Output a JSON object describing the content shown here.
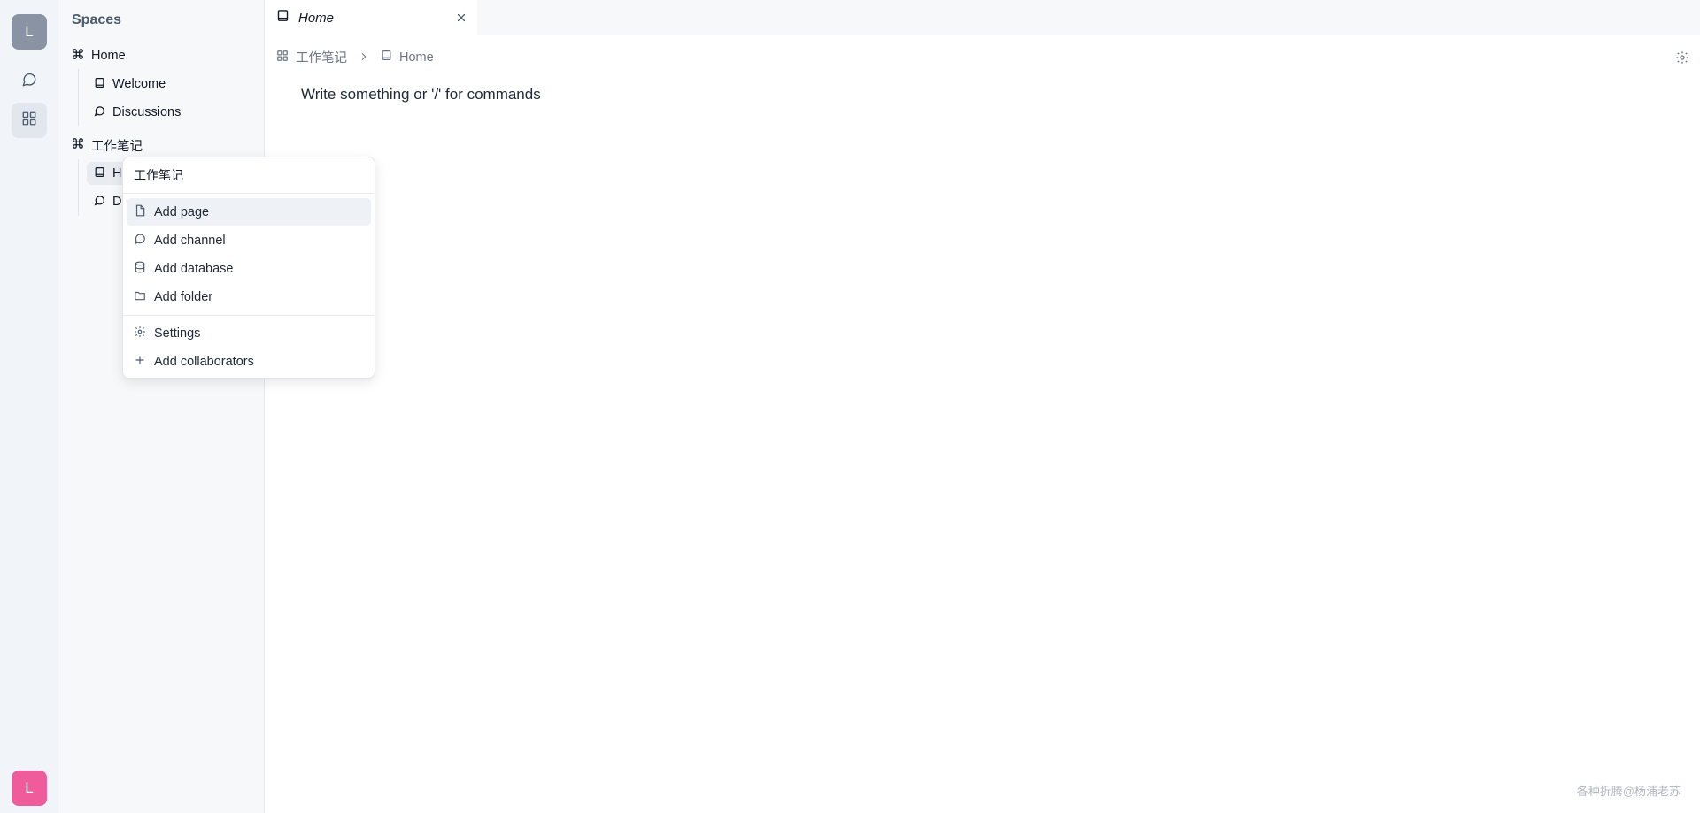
{
  "rail": {
    "user_initial_top": "L",
    "user_initial_bottom": "L",
    "chat_icon": "chat-bubble-icon",
    "spaces_icon": "grid-icon"
  },
  "sidebar": {
    "title": "Spaces",
    "spaces": [
      {
        "label": "Home",
        "icon": "command-icon",
        "children": [
          {
            "label": "Welcome",
            "icon": "book-icon"
          },
          {
            "label": "Discussions",
            "icon": "chat-bubble-icon"
          }
        ]
      },
      {
        "label": "工作笔记",
        "icon": "command-icon",
        "children": [
          {
            "label": "H",
            "icon": "book-icon"
          },
          {
            "label": "D",
            "icon": "chat-bubble-icon"
          }
        ]
      }
    ]
  },
  "tabs": [
    {
      "label": "Home",
      "icon": "book-icon",
      "close_icon": "close-icon"
    }
  ],
  "breadcrumb": {
    "items": [
      {
        "label": "工作笔记",
        "icon": "command-icon"
      },
      {
        "label": "Home",
        "icon": "book-icon"
      }
    ],
    "separator_icon": "chevron-right-icon"
  },
  "settings_icon": "gear-icon",
  "editor": {
    "placeholder": "Write something or '/' for commands"
  },
  "context_menu": {
    "header": "工作笔记",
    "items": [
      {
        "label": "Add page",
        "icon": "file-icon"
      },
      {
        "label": "Add channel",
        "icon": "chat-bubble-icon"
      },
      {
        "label": "Add database",
        "icon": "database-icon"
      },
      {
        "label": "Add folder",
        "icon": "folder-icon"
      }
    ],
    "secondary_items": [
      {
        "label": "Settings",
        "icon": "gear-icon"
      },
      {
        "label": "Add collaborators",
        "icon": "plus-icon"
      }
    ]
  },
  "watermark": "各种折腾@杨浦老苏",
  "colors": {
    "rail_bg": "#f1f4f8",
    "sidebar_bg": "#f7f8fa",
    "avatar_top": "#8a93a3",
    "avatar_bottom": "#f05c9b",
    "muted_text": "#6b7787"
  }
}
